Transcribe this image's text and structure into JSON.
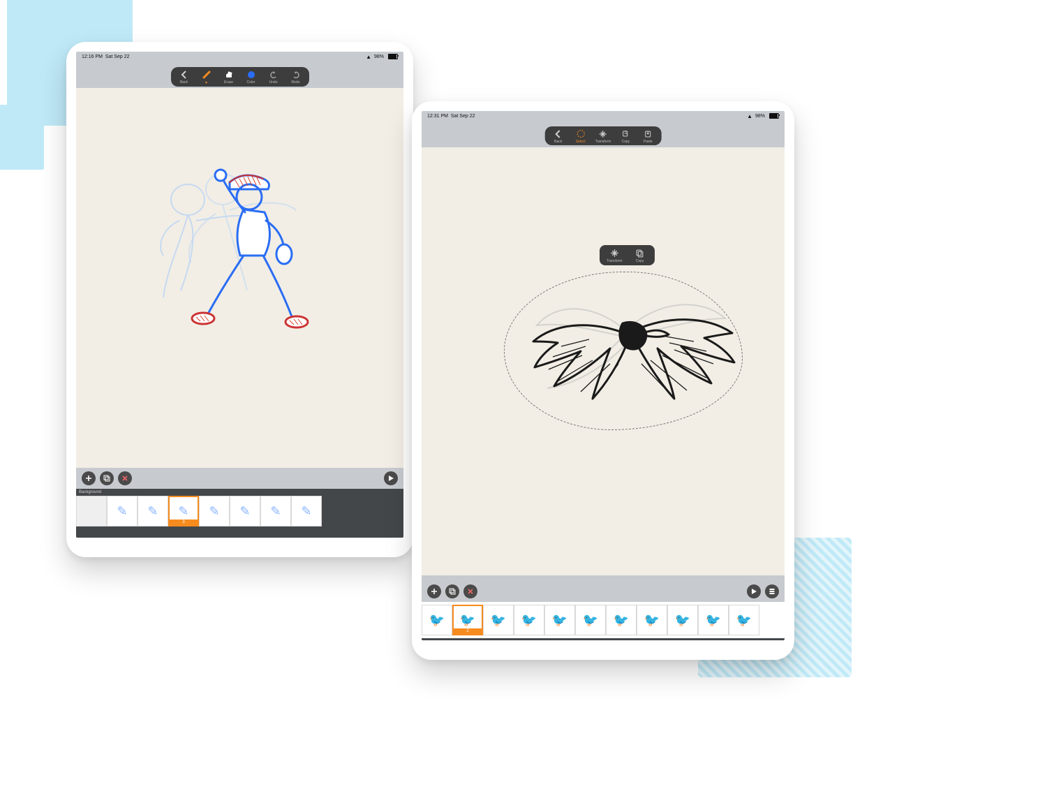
{
  "left": {
    "status": {
      "time": "12:16 PM",
      "date": "Sat Sep 22",
      "battery": "98%"
    },
    "toolbar": [
      {
        "id": "back",
        "label": "Back"
      },
      {
        "id": "brush",
        "label": ""
      },
      {
        "id": "erase",
        "label": "Erase"
      },
      {
        "id": "color",
        "label": "Color"
      },
      {
        "id": "undo",
        "label": "Undo"
      },
      {
        "id": "redo",
        "label": "Redo"
      }
    ],
    "timeline_label": "Background",
    "selected_frame_index": 3,
    "selected_frame_label": "3",
    "frames_count": 7,
    "bottom_buttons_left": [
      "add",
      "duplicate",
      "delete"
    ],
    "bottom_buttons_right": [
      "play"
    ]
  },
  "right": {
    "status": {
      "time": "12:31 PM",
      "date": "Sat Sep 22",
      "battery": "98%"
    },
    "toolbar": [
      {
        "id": "back",
        "label": "Back"
      },
      {
        "id": "select",
        "label": "Select"
      },
      {
        "id": "transform",
        "label": "Transform"
      },
      {
        "id": "copy",
        "label": "Copy"
      },
      {
        "id": "paste",
        "label": "Paste"
      }
    ],
    "context_menu": [
      {
        "id": "transform",
        "label": "Transform"
      },
      {
        "id": "copy",
        "label": "Copy"
      }
    ],
    "selected_frame_index": 1,
    "selected_frame_label": "2",
    "frames_count": 11,
    "bottom_buttons_left": [
      "add",
      "duplicate",
      "delete"
    ],
    "bottom_buttons_right": [
      "play",
      "settings"
    ]
  },
  "colors": {
    "accent": "#f68b1f",
    "brush_color": "#2a6df4"
  }
}
